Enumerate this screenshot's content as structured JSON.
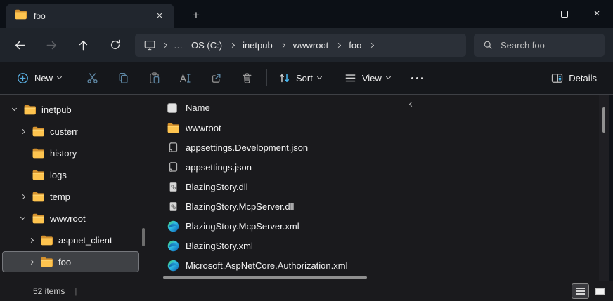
{
  "titlebar": {
    "tab_label": "foo",
    "tab_close_glyph": "×",
    "new_tab_glyph": "+",
    "minimize_glyph": "—",
    "close_glyph": "×"
  },
  "navbar": {
    "address": {
      "ellipsis": "…",
      "crumbs": [
        "OS (C:)",
        "inetpub",
        "wwwroot",
        "foo"
      ]
    },
    "search": {
      "placeholder": "Search foo"
    }
  },
  "toolbar": {
    "new_label": "New",
    "sort_label": "Sort",
    "view_label": "View",
    "details_label": "Details"
  },
  "sidebar": {
    "items": [
      {
        "label": "inetpub",
        "level": 1,
        "chevron": "expanded",
        "selected": false
      },
      {
        "label": "custerr",
        "level": 2,
        "chevron": "collapsed",
        "selected": false
      },
      {
        "label": "history",
        "level": 2,
        "chevron": "none",
        "selected": false
      },
      {
        "label": "logs",
        "level": 2,
        "chevron": "none",
        "selected": false
      },
      {
        "label": "temp",
        "level": 2,
        "chevron": "collapsed",
        "selected": false
      },
      {
        "label": "wwwroot",
        "level": 2,
        "chevron": "expanded",
        "selected": false
      },
      {
        "label": "aspnet_client",
        "level": 3,
        "chevron": "collapsed",
        "selected": false
      },
      {
        "label": "foo",
        "level": 3,
        "chevron": "collapsed",
        "selected": true
      }
    ]
  },
  "filelist": {
    "column_header": "Name",
    "rows": [
      {
        "name": "wwwroot",
        "icon": "folder-icon"
      },
      {
        "name": "appsettings.Development.json",
        "icon": "json-file-icon"
      },
      {
        "name": "appsettings.json",
        "icon": "json-file-icon"
      },
      {
        "name": "BlazingStory.dll",
        "icon": "dll-file-icon"
      },
      {
        "name": "BlazingStory.McpServer.dll",
        "icon": "dll-file-icon"
      },
      {
        "name": "BlazingStory.McpServer.xml",
        "icon": "edge-xml-icon"
      },
      {
        "name": "BlazingStory.xml",
        "icon": "edge-xml-icon"
      },
      {
        "name": "Microsoft.AspNetCore.Authorization.xml",
        "icon": "edge-xml-icon"
      }
    ]
  },
  "statusbar": {
    "items_count": "52 items",
    "separator_glyph": "|"
  },
  "icons": {
    "tab-folder-icon": "yellow-folder",
    "back-icon": "arrow-left",
    "forward-icon": "arrow-right",
    "up-icon": "arrow-up",
    "refresh-icon": "circular-arrow",
    "this-pc-icon": "monitor",
    "search-icon": "magnifier",
    "new-icon": "circled-plus",
    "cut-icon": "scissors",
    "copy-icon": "two-pages",
    "paste-icon": "clipboard",
    "rename-icon": "a-with-cursor",
    "share-icon": "box-arrow-out",
    "delete-icon": "trash-can",
    "sort-icon": "up-down-arrows",
    "view-icon": "stacked-lines",
    "more-options-icon": "three-dots",
    "details-panel-icon": "split-panel",
    "details-view-icon": "stacked-lines",
    "large-thumbnails-icon": "filled-rectangle"
  },
  "colors": {
    "accent_blue": "#4cc2ff",
    "steel_blue_icon": "#5f88a5",
    "folder_yellow": "#fec44f",
    "selection_bg": "#3f4145",
    "titlebar_bg": "#0c1016",
    "bar_bg": "#1f242b",
    "pill_bg": "#2b3038",
    "content_bg": "#1a1a1d"
  }
}
